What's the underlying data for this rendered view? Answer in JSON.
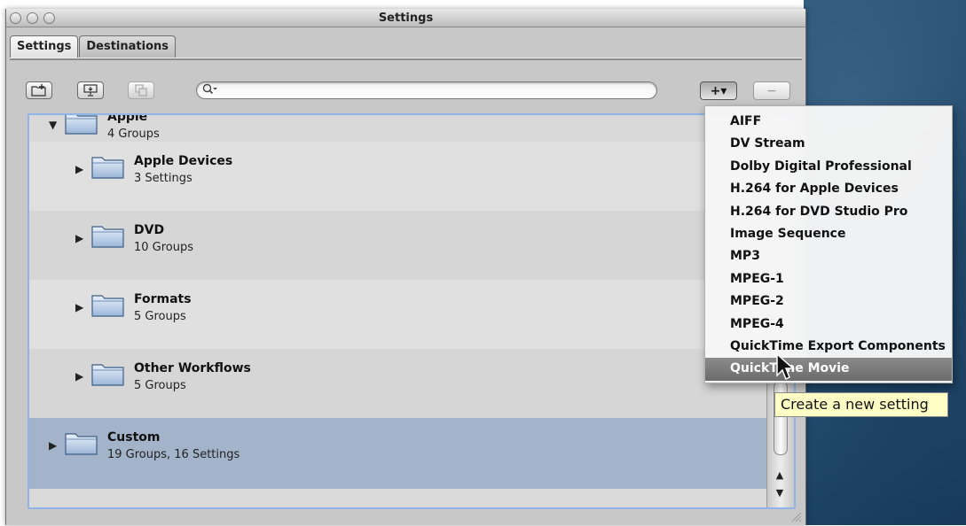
{
  "window": {
    "title": "Settings"
  },
  "tabs": [
    {
      "label": "Settings",
      "active": true
    },
    {
      "label": "Destinations",
      "active": false
    }
  ],
  "toolbar": {
    "new_group_icon": "folder-plus-icon",
    "add_setting_icon": "monitor-icon",
    "duplicate_icon": "duplicate-icon",
    "search_placeholder": "",
    "search_icon": "magnifier-icon",
    "add_button_label": "+▾",
    "remove_button_label": "−"
  },
  "groups": [
    {
      "name": "Apple",
      "sub": "4 Groups",
      "expanded": true
    },
    {
      "name": "Apple Devices",
      "sub": "3 Settings",
      "expanded": false
    },
    {
      "name": "DVD",
      "sub": "10 Groups",
      "expanded": false
    },
    {
      "name": "Formats",
      "sub": "5 Groups",
      "expanded": false
    },
    {
      "name": "Other Workflows",
      "sub": "5 Groups",
      "expanded": false
    },
    {
      "name": "Custom",
      "sub": "19 Groups, 16 Settings",
      "expanded": false
    }
  ],
  "add_menu": {
    "items": [
      "AIFF",
      "DV Stream",
      "Dolby Digital Professional",
      "H.264 for Apple Devices",
      "H.264 for DVD Studio Pro",
      "Image Sequence",
      "MP3",
      "MPEG-1",
      "MPEG-2",
      "MPEG-4",
      "QuickTime Export Components",
      "QuickTime Movie"
    ],
    "highlighted": "QuickTime Movie"
  },
  "tooltip": "Create a new setting",
  "colors": {
    "list_row_light": "#dcdcdc",
    "list_row_alt": "#e6e6e6",
    "selected_row": "#9eb0c8",
    "menu_highlight": "#7a7a7a",
    "tooltip_bg": "#ffffc6",
    "focus_ring": "#8fb4e8"
  }
}
